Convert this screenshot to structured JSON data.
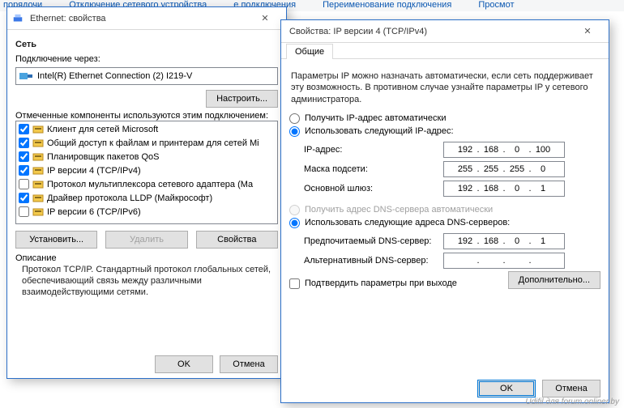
{
  "bg_toolbar": [
    "порядочи",
    "Отключение сетевого устройства",
    "е подключения",
    "Переименование подключения",
    "Просмот"
  ],
  "left": {
    "title": "Ethernet: свойства",
    "section_net": "Сеть",
    "connect_via": "Подключение через:",
    "adapter_name": "Intel(R) Ethernet Connection (2) I219-V",
    "configure_btn": "Настроить...",
    "components_label": "Отмеченные компоненты используются этим подключением:",
    "components": [
      {
        "checked": true,
        "label": "Клиент для сетей Microsoft"
      },
      {
        "checked": true,
        "label": "Общий доступ к файлам и принтерам для сетей Mi"
      },
      {
        "checked": true,
        "label": "Планировщик пакетов QoS"
      },
      {
        "checked": true,
        "label": "IP версии 4 (TCP/IPv4)"
      },
      {
        "checked": false,
        "label": "Протокол мультиплексора сетевого адаптера (Ма"
      },
      {
        "checked": true,
        "label": "Драйвер протокола LLDP (Майкрософт)"
      },
      {
        "checked": false,
        "label": "IP версии 6 (TCP/IPv6)"
      }
    ],
    "install_btn": "Установить...",
    "remove_btn": "Удалить",
    "props_btn": "Свойства",
    "desc_label": "Описание",
    "desc_text": "Протокол TCP/IP. Стандартный протокол глобальных сетей, обеспечивающий связь между различными взаимодействующими сетями.",
    "ok": "OK",
    "cancel": "Отмена"
  },
  "right": {
    "title": "Свойства: IP версии 4 (TCP/IPv4)",
    "tab_general": "Общие",
    "instructions": "Параметры IP можно назначать автоматически, если сеть поддерживает эту возможность. В противном случае узнайте параметры IP у сетевого администратора.",
    "radio_auto_ip": "Получить IP-адрес автоматически",
    "radio_static_ip": "Использовать следующий IP-адрес:",
    "label_ip": "IP-адрес:",
    "label_mask": "Маска подсети:",
    "label_gw": "Основной шлюз:",
    "ip": [
      "192",
      "168",
      "0",
      "100"
    ],
    "mask": [
      "255",
      "255",
      "255",
      "0"
    ],
    "gw": [
      "192",
      "168",
      "0",
      "1"
    ],
    "radio_auto_dns": "Получить адрес DNS-сервера автоматически",
    "radio_static_dns": "Использовать следующие адреса DNS-серверов:",
    "label_dns1": "Предпочитаемый DNS-сервер:",
    "label_dns2": "Альтернативный DNS-сервер:",
    "dns1": [
      "192",
      "168",
      "0",
      "1"
    ],
    "dns2": [
      "",
      "",
      "",
      ""
    ],
    "validate_chk": "Подтвердить параметры при выходе",
    "advanced_btn": "Дополнительно...",
    "ok": "OK",
    "cancel": "Отмена"
  },
  "watermark": "Udifil для forum.onliner.by"
}
